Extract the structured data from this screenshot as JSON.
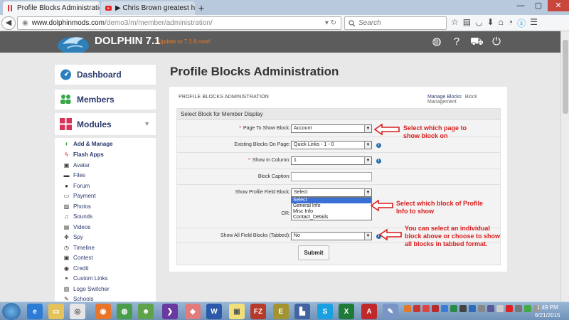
{
  "browser": {
    "tabs": [
      {
        "title": "Profile Blocks Administration",
        "active": true
      },
      {
        "title": "▶ Chris Brown greatest hit...",
        "active": false
      }
    ],
    "url_host": "www.dolphinmods.com",
    "url_path": "/demo3/m/member/administration/",
    "search_placeholder": "Search"
  },
  "app": {
    "brand": "DOLPHIN 7.1",
    "update_notice": "Update to 7.1.6 now!"
  },
  "sidebar": {
    "dashboard": "Dashboard",
    "members": "Members",
    "modules": "Modules",
    "module_items": [
      "Add & Manage",
      "Flash Apps",
      "Avatar",
      "Files",
      "Forum",
      "Payment",
      "Photos",
      "Sounds",
      "Videos",
      "Spy",
      "Timeline",
      "Contest",
      "Credit",
      "Custom Links",
      "Logo Switcher",
      "Schools"
    ]
  },
  "main": {
    "page_title": "Profile Blocks Administration",
    "card_title": "PROFILE BLOCKS ADMINISTRATION",
    "link_manage": "Manage Blocks",
    "link_management": "Block Management",
    "form_header": "Select Block for Member Display",
    "fields": {
      "page_label": "Page To Show Block:",
      "page_value": "Account",
      "existing_label": "Existing Blocks On Page:",
      "existing_value": "Quick Links - 1 - 0",
      "column_label": "Show In Column:",
      "column_value": "1",
      "caption_label": "Block Caption:",
      "profile_field_label": "Show Profile Field Block:",
      "profile_field_value": "Select",
      "profile_field_options": [
        "Select",
        "General Info",
        "Misc Info",
        "Contact_Details"
      ],
      "or_label": "OR:",
      "all_blocks_label": "Show All Field Blocks (Tabbed):",
      "all_blocks_value": "No"
    },
    "submit_label": "Submit"
  },
  "annotations": {
    "a1": [
      "Select which page to",
      "show block on"
    ],
    "a2": [
      "Select which block of Profile",
      "Info to show"
    ],
    "a3": [
      "You can select an individual",
      "block above or choose to show",
      "all blocks in tabbed format."
    ]
  },
  "taskbar": {
    "time": "1:49 PM",
    "date": "6/21/2015"
  }
}
